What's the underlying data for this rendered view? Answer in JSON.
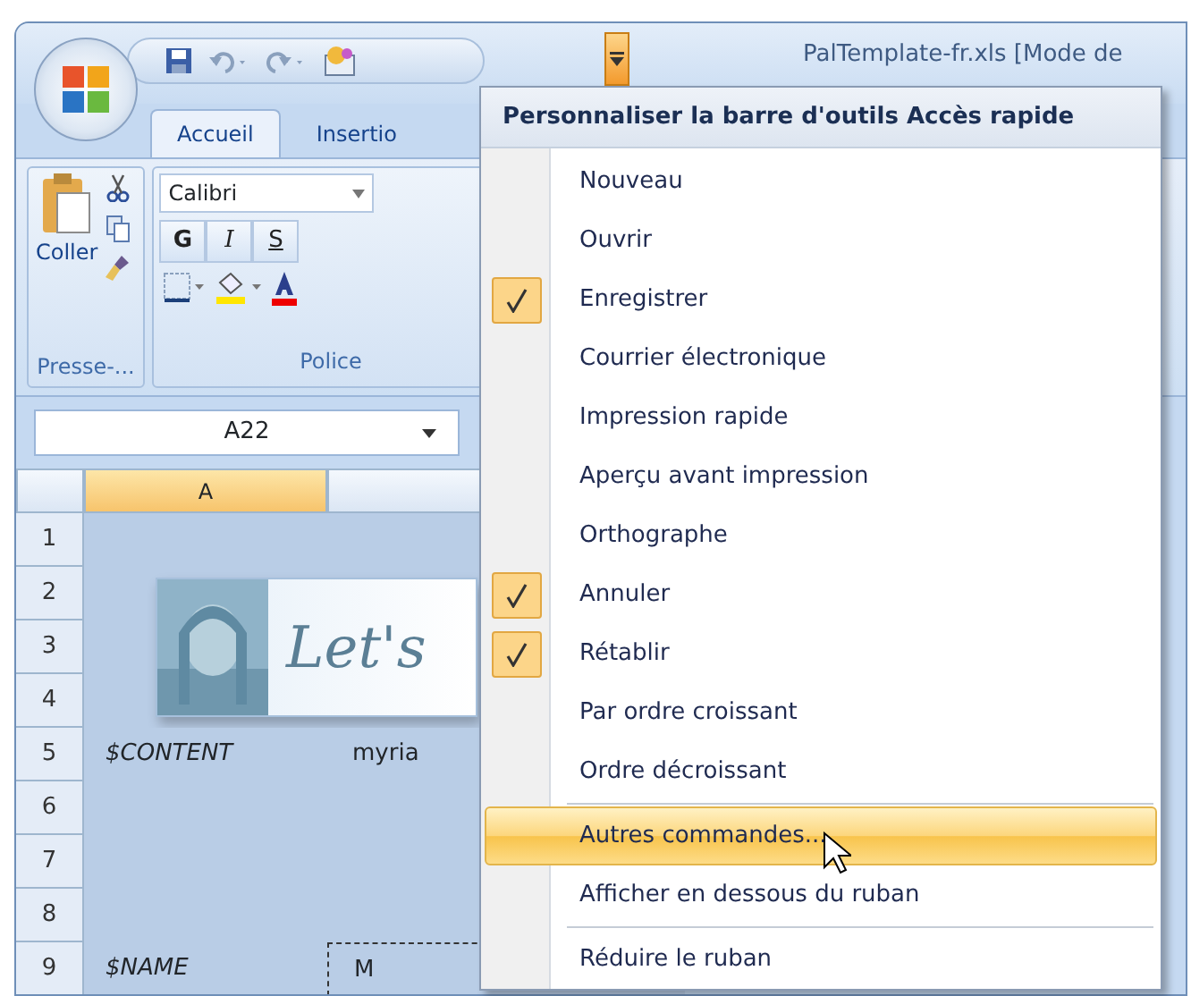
{
  "window": {
    "title": "PalTemplate-fr.xls  [Mode de"
  },
  "quick_access": {
    "customize_open": true
  },
  "tabs": [
    {
      "label": "Accueil",
      "selected": true
    },
    {
      "label": "Insertio",
      "selected": false
    }
  ],
  "ribbon": {
    "clipboard": {
      "paste_label": "Coller",
      "group_label": "Presse-..."
    },
    "font": {
      "font_name": "Calibri",
      "format_buttons": [
        "G",
        "I",
        "S"
      ],
      "group_label": "Police"
    }
  },
  "name_box": "A22",
  "sheet": {
    "columns": [
      {
        "label": "A",
        "selected": true
      }
    ],
    "banner_text": "Let's",
    "rows": [
      {
        "number": "1",
        "cells": []
      },
      {
        "number": "2",
        "cells": []
      },
      {
        "number": "3",
        "cells": []
      },
      {
        "number": "4",
        "cells": []
      },
      {
        "number": "5",
        "cells": [
          "$CONTENT",
          "myria"
        ]
      },
      {
        "number": "6",
        "cells": []
      },
      {
        "number": "7",
        "cells": []
      },
      {
        "number": "8",
        "cells": []
      },
      {
        "number": "9",
        "cells": [
          "$NAME",
          "M"
        ]
      }
    ]
  },
  "menu": {
    "title": "Personnaliser la barre d'outils Accès rapide",
    "items": [
      {
        "kind": "option",
        "label": "Nouveau",
        "checked": false
      },
      {
        "kind": "option",
        "label": "Ouvrir",
        "checked": false
      },
      {
        "kind": "option",
        "label": "Enregistrer",
        "checked": true
      },
      {
        "kind": "option",
        "label": "Courrier électronique",
        "checked": false
      },
      {
        "kind": "option",
        "label": "Impression rapide",
        "checked": false
      },
      {
        "kind": "option",
        "label": "Aperçu avant impression",
        "checked": false
      },
      {
        "kind": "option",
        "label": "Orthographe",
        "checked": false
      },
      {
        "kind": "option",
        "label": "Annuler",
        "checked": true
      },
      {
        "kind": "option",
        "label": "Rétablir",
        "checked": true
      },
      {
        "kind": "option",
        "label": "Par ordre croissant",
        "checked": false
      },
      {
        "kind": "option",
        "label": "Ordre décroissant",
        "checked": false
      },
      {
        "kind": "separator"
      },
      {
        "kind": "command",
        "label": "Autres commandes...",
        "highlighted": true
      },
      {
        "kind": "command",
        "label": "Afficher en dessous du ruban",
        "highlighted": false
      },
      {
        "kind": "separator"
      },
      {
        "kind": "command",
        "label": "Réduire le ruban",
        "highlighted": false
      }
    ]
  }
}
